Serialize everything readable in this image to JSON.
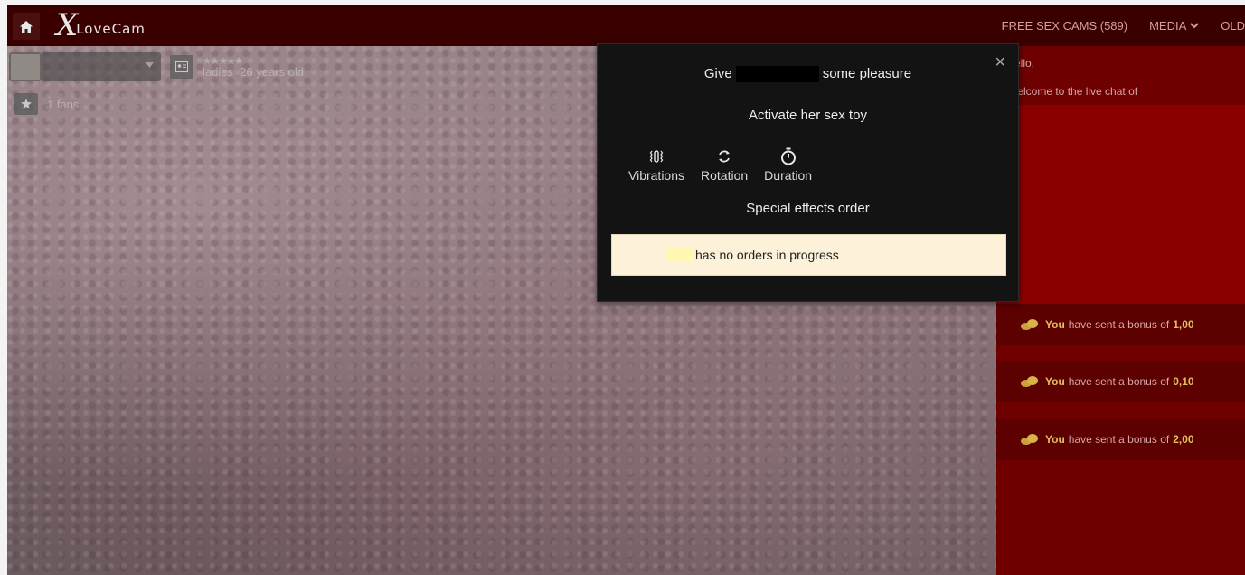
{
  "header": {
    "logo_x": "X",
    "logo_rest": "LoveCam",
    "nav": [
      {
        "label": "FREE SEX CAMS (589)",
        "has_dropdown": false
      },
      {
        "label": "MEDIA",
        "has_dropdown": true
      },
      {
        "label": "OLD",
        "has_dropdown": false
      }
    ]
  },
  "model": {
    "category": "ladies",
    "age": "26 years old",
    "stars": "★★★★★",
    "fans": "1 fans"
  },
  "chat": {
    "greeting": "ello,",
    "welcome": "/elcome to the live chat of",
    "bonuses": [
      {
        "you": "You",
        "text": "have sent a bonus of",
        "amount": "1,00"
      },
      {
        "you": "You",
        "text": "have sent a bonus of",
        "amount": "0,10"
      },
      {
        "you": "You",
        "text": "have sent a bonus of",
        "amount": "2,00"
      }
    ]
  },
  "popup": {
    "close": "×",
    "title_prefix": "Give",
    "title_suffix": "some pleasure",
    "subtitle": "Activate her sex toy",
    "options": [
      {
        "label": "Vibrations",
        "icon": "vibration-icon"
      },
      {
        "label": "Rotation",
        "icon": "rotation-icon"
      },
      {
        "label": "Duration",
        "icon": "timer-icon"
      }
    ],
    "orders_title": "Special effects order",
    "orders_text": "has no orders in progress"
  },
  "colors": {
    "topbar": "#3a0000",
    "chat_bg": "#6e0000",
    "popup_bg": "#131313",
    "accent_gold": "#e2c060",
    "orders_box": "#fdf2d9"
  }
}
